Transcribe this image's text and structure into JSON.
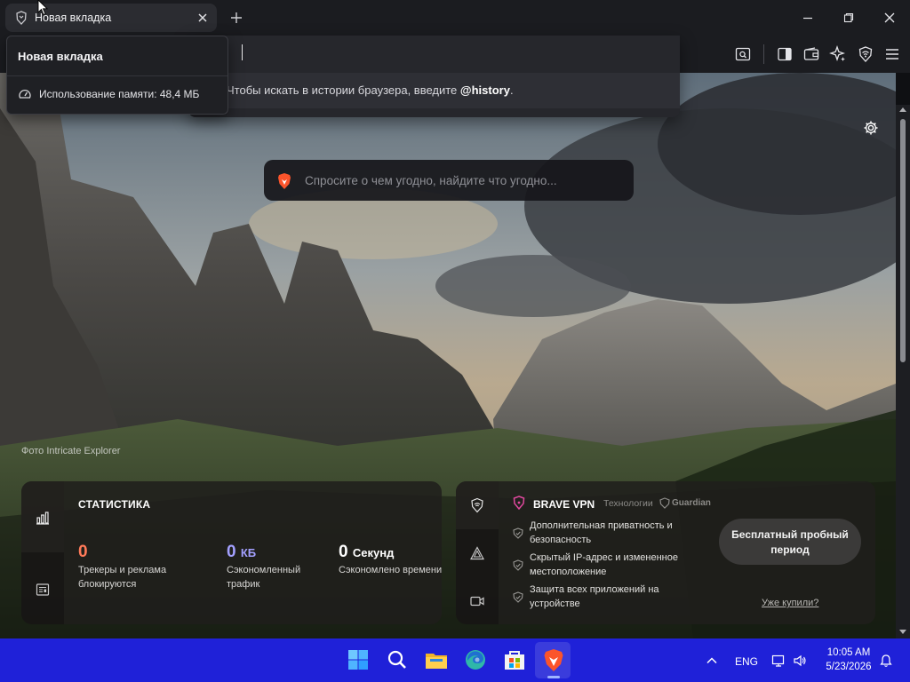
{
  "tab": {
    "title": "Новая вкладка",
    "icon": "brave-shield-icon"
  },
  "tooltip": {
    "title": "Новая вкладка",
    "memory": "Использование памяти: 48,4 МБ"
  },
  "omnibox": {
    "hint_prefix": "Чтобы искать в истории браузера, введите ",
    "hint_keyword": "@history",
    "hint_suffix": "."
  },
  "search": {
    "placeholder": "Спросите о чем угодно, найдите что угодно..."
  },
  "photo_credit": "Фото Intricate Explorer",
  "stats": {
    "title": "СТАТИСТИКА",
    "items": [
      {
        "value": "0",
        "unit": "",
        "label": "Трекеры и реклама блокируются",
        "color": "#ff7a59"
      },
      {
        "value": "0",
        "unit": "КБ",
        "label": "Сэкономленный трафик",
        "color": "#a3a0ff"
      },
      {
        "value": "0",
        "unit": "Секунд",
        "label": "Сэкономлено времени",
        "color": "#ffffff"
      }
    ]
  },
  "vpn": {
    "title": "BRAVE VPN",
    "tech_label": "Технологии",
    "tech_brand": "Guardian",
    "features": [
      "Дополнительная приватность и безопасность",
      "Скрытый IP-адрес и измененное местоположение",
      "Защита всех приложений на устройстве"
    ],
    "trial_button": "Бесплатный пробный период",
    "already_bought": "Уже купили?"
  },
  "taskbar": {
    "apps": [
      "windows-start-icon",
      "search-icon",
      "file-explorer-icon",
      "edge-icon",
      "store-icon",
      "brave-icon"
    ],
    "lang": "ENG",
    "time": "10:05 AM",
    "date": "5/23/2026"
  },
  "colors": {
    "accent": "#fb542b",
    "taskbar": "#1f21d8",
    "chrome": "#1b1c20"
  }
}
